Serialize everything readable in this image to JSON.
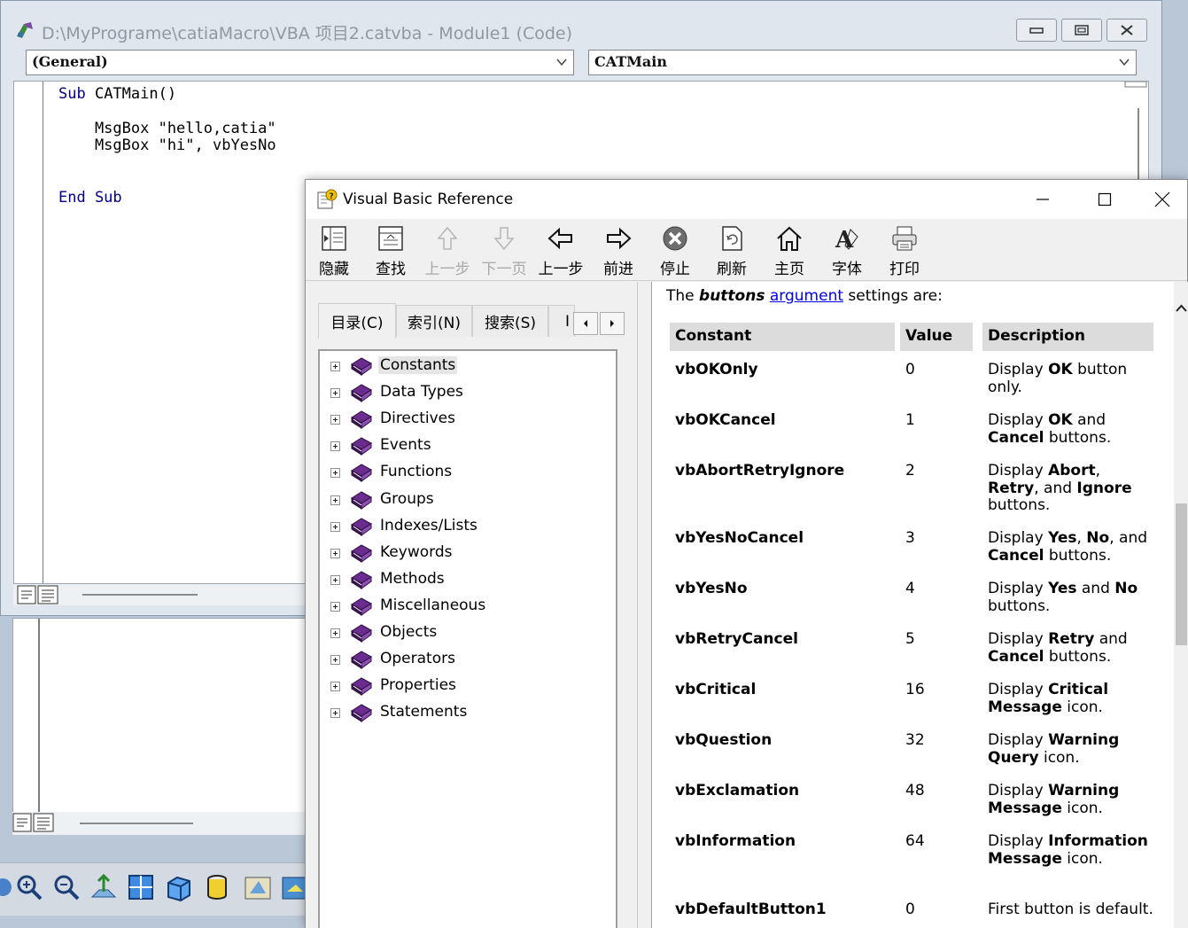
{
  "vba": {
    "title": "D:\\MyPrograme\\catiaMacro\\VBA 项目2.catvba - Module1 (Code)",
    "object_combo": "(General)",
    "procedure_combo": "CATMain",
    "code": {
      "sub_kw": "Sub",
      "sub_name": " CATMain()",
      "line_msg1": "    MsgBox \"hello,catia\"",
      "line_msg2": "    MsgBox \"hi\", vbYesNo",
      "end_sub": "End Sub"
    }
  },
  "help": {
    "title": "Visual Basic Reference",
    "toolbar": [
      {
        "label": "隐藏",
        "icon": "hide-icon",
        "enabled": true
      },
      {
        "label": "查找",
        "icon": "locate-icon",
        "enabled": true
      },
      {
        "label": "上一步",
        "icon": "up-arrow-icon",
        "enabled": false
      },
      {
        "label": "下一页",
        "icon": "down-arrow-icon",
        "enabled": false
      },
      {
        "label": "上一步",
        "icon": "back-arrow-icon",
        "enabled": true
      },
      {
        "label": "前进",
        "icon": "forward-arrow-icon",
        "enabled": true
      },
      {
        "label": "停止",
        "icon": "stop-icon",
        "enabled": true
      },
      {
        "label": "刷新",
        "icon": "refresh-icon",
        "enabled": true
      },
      {
        "label": "主页",
        "icon": "home-icon",
        "enabled": true
      },
      {
        "label": "字体",
        "icon": "font-icon",
        "enabled": true
      },
      {
        "label": "打印",
        "icon": "print-icon",
        "enabled": true
      }
    ],
    "tabs": {
      "contents": "目录(C)",
      "index": "索引(N)",
      "search": "搜索(S)",
      "more_clipped": "I"
    },
    "tree": [
      "Constants",
      "Data Types",
      "Directives",
      "Events",
      "Functions",
      "Groups",
      "Indexes/Lists",
      "Keywords",
      "Methods",
      "Miscellaneous",
      "Objects",
      "Operators",
      "Properties",
      "Statements"
    ],
    "content": {
      "intro_pre": "The ",
      "intro_bold": "buttons",
      "intro_link": "argument",
      "intro_post": " settings are:",
      "headers": {
        "constant": "Constant",
        "value": "Value",
        "description": "Description"
      },
      "rows": [
        {
          "constant": "vbOKOnly",
          "value": "0",
          "desc": [
            [
              "Display ",
              0
            ],
            [
              "OK",
              1
            ],
            [
              " button only.",
              0
            ]
          ]
        },
        {
          "constant": "vbOKCancel",
          "value": "1",
          "desc": [
            [
              "Display ",
              0
            ],
            [
              "OK",
              1
            ],
            [
              " and ",
              0
            ],
            [
              "Cancel",
              1
            ],
            [
              " buttons.",
              0
            ]
          ]
        },
        {
          "constant": "vbAbortRetryIgnore",
          "value": "2",
          "desc": [
            [
              "Display ",
              0
            ],
            [
              "Abort",
              1
            ],
            [
              ", ",
              0
            ],
            [
              "Retry",
              1
            ],
            [
              ", and ",
              0
            ],
            [
              "Ignore",
              1
            ],
            [
              " buttons.",
              0
            ]
          ]
        },
        {
          "constant": "vbYesNoCancel",
          "value": "3",
          "desc": [
            [
              "Display ",
              0
            ],
            [
              "Yes",
              1
            ],
            [
              ", ",
              0
            ],
            [
              "No",
              1
            ],
            [
              ", and ",
              0
            ],
            [
              "Cancel",
              1
            ],
            [
              " buttons.",
              0
            ]
          ]
        },
        {
          "constant": "vbYesNo",
          "value": "4",
          "desc": [
            [
              "Display ",
              0
            ],
            [
              "Yes",
              1
            ],
            [
              " and ",
              0
            ],
            [
              "No",
              1
            ],
            [
              " buttons.",
              0
            ]
          ]
        },
        {
          "constant": "vbRetryCancel",
          "value": "5",
          "desc": [
            [
              "Display ",
              0
            ],
            [
              "Retry",
              1
            ],
            [
              " and ",
              0
            ],
            [
              "Cancel",
              1
            ],
            [
              " buttons.",
              0
            ]
          ]
        },
        {
          "constant": "vbCritical",
          "value": "16",
          "desc": [
            [
              "Display ",
              0
            ],
            [
              "Critical Message",
              1
            ],
            [
              " icon.",
              0
            ]
          ]
        },
        {
          "constant": "vbQuestion",
          "value": "32",
          "desc": [
            [
              "Display ",
              0
            ],
            [
              "Warning Query",
              1
            ],
            [
              " icon.",
              0
            ]
          ]
        },
        {
          "constant": "vbExclamation",
          "value": "48",
          "desc": [
            [
              "Display ",
              0
            ],
            [
              "Warning Message",
              1
            ],
            [
              " icon.",
              0
            ]
          ]
        },
        {
          "constant": "vbInformation",
          "value": "64",
          "desc": [
            [
              "Display ",
              0
            ],
            [
              "Information Message",
              1
            ],
            [
              " icon.",
              0
            ]
          ]
        },
        {
          "constant": "vbDefaultButton1",
          "value": "0",
          "desc": [
            [
              "First button is default.",
              0
            ]
          ]
        }
      ]
    }
  },
  "colors": {
    "link": "#0000ee",
    "book": "#6b2c8f",
    "keyword": "#00008b"
  }
}
